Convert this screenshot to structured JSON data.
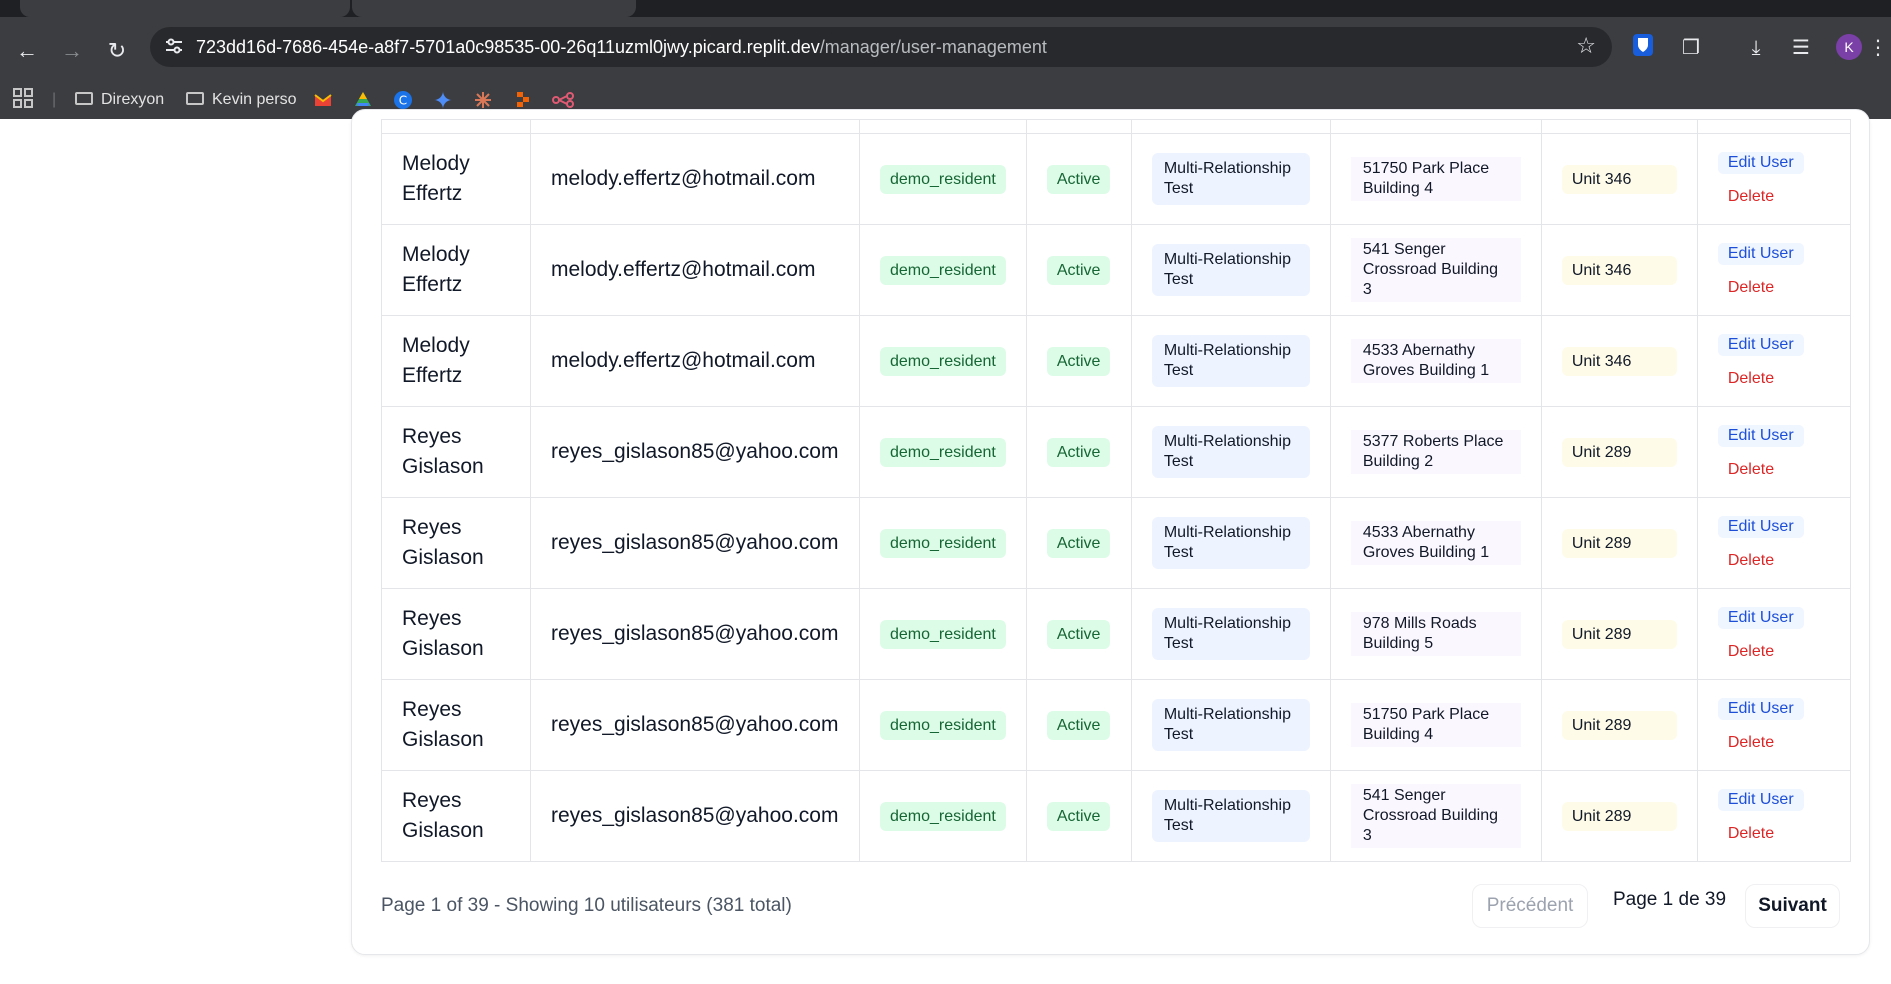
{
  "browser": {
    "url_host": "723dd16d-7686-454e-a8f7-5701a0c98535-00-26q11uzml0jwy.picard.replit.dev",
    "url_path": "/manager/user-management",
    "profile_initial": "K",
    "bookmarks": [
      "Direxyon",
      "Kevin perso"
    ]
  },
  "table": {
    "rows": [
      {
        "name": "Melody Effertz",
        "email": "melody.effertz@hotmail.com",
        "role": "demo_resident",
        "status": "Active",
        "group": "Multi-Relationship Test",
        "building": "51750 Park Place Building 4",
        "unit": "Unit 346",
        "edit": "Edit User",
        "delete": "Delete"
      },
      {
        "name": "Melody Effertz",
        "email": "melody.effertz@hotmail.com",
        "role": "demo_resident",
        "status": "Active",
        "group": "Multi-Relationship Test",
        "building": "541 Senger Crossroad Building 3",
        "unit": "Unit 346",
        "edit": "Edit User",
        "delete": "Delete"
      },
      {
        "name": "Melody Effertz",
        "email": "melody.effertz@hotmail.com",
        "role": "demo_resident",
        "status": "Active",
        "group": "Multi-Relationship Test",
        "building": "4533 Abernathy Groves Building 1",
        "unit": "Unit 346",
        "edit": "Edit User",
        "delete": "Delete"
      },
      {
        "name": "Reyes Gislason",
        "email": "reyes_gislason85@yahoo.com",
        "role": "demo_resident",
        "status": "Active",
        "group": "Multi-Relationship Test",
        "building": "5377 Roberts Place Building 2",
        "unit": "Unit 289",
        "edit": "Edit User",
        "delete": "Delete"
      },
      {
        "name": "Reyes Gislason",
        "email": "reyes_gislason85@yahoo.com",
        "role": "demo_resident",
        "status": "Active",
        "group": "Multi-Relationship Test",
        "building": "4533 Abernathy Groves Building 1",
        "unit": "Unit 289",
        "edit": "Edit User",
        "delete": "Delete"
      },
      {
        "name": "Reyes Gislason",
        "email": "reyes_gislason85@yahoo.com",
        "role": "demo_resident",
        "status": "Active",
        "group": "Multi-Relationship Test",
        "building": "978 Mills Roads Building 5",
        "unit": "Unit 289",
        "edit": "Edit User",
        "delete": "Delete"
      },
      {
        "name": "Reyes Gislason",
        "email": "reyes_gislason85@yahoo.com",
        "role": "demo_resident",
        "status": "Active",
        "group": "Multi-Relationship Test",
        "building": "51750 Park Place Building 4",
        "unit": "Unit 289",
        "edit": "Edit User",
        "delete": "Delete"
      },
      {
        "name": "Reyes Gislason",
        "email": "reyes_gislason85@yahoo.com",
        "role": "demo_resident",
        "status": "Active",
        "group": "Multi-Relationship Test",
        "building": "541 Senger Crossroad Building 3",
        "unit": "Unit 289",
        "edit": "Edit User",
        "delete": "Delete"
      }
    ]
  },
  "pagination": {
    "summary": "Page 1 of 39 - Showing 10 utilisateurs (381 total)",
    "prev_label": "Précédent",
    "indicator": "Page 1 de 39",
    "next_label": "Suivant"
  }
}
